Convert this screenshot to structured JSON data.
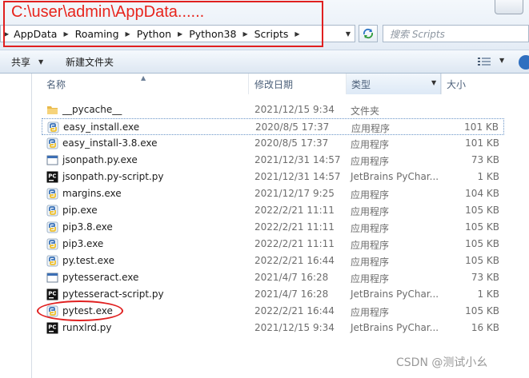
{
  "annotation": {
    "text": "C:\\user\\admin\\AppData......"
  },
  "breadcrumb": [
    "AppData",
    "Roaming",
    "Python",
    "Python38",
    "Scripts"
  ],
  "search": {
    "placeholder": "搜索 Scripts"
  },
  "toolbar": {
    "share_label": "共享",
    "new_folder_label": "新建文件夹"
  },
  "columns": {
    "name": "名称",
    "date": "修改日期",
    "type": "类型",
    "size": "大小"
  },
  "files": [
    {
      "name": "__pycache__",
      "date": "2021/12/15 9:34",
      "type": "文件夹",
      "size": "",
      "icon": "folder-icon"
    },
    {
      "name": "easy_install.exe",
      "date": "2020/8/5 17:37",
      "type": "应用程序",
      "size": "101 KB",
      "icon": "python-exe-icon"
    },
    {
      "name": "easy_install-3.8.exe",
      "date": "2020/8/5 17:37",
      "type": "应用程序",
      "size": "101 KB",
      "icon": "python-exe-icon"
    },
    {
      "name": "jsonpath.py.exe",
      "date": "2021/12/31 14:57",
      "type": "应用程序",
      "size": "73 KB",
      "icon": "window-exe-icon"
    },
    {
      "name": "jsonpath.py-script.py",
      "date": "2021/12/31 14:57",
      "type": "JetBrains PyChar...",
      "size": "1 KB",
      "icon": "pycharm-file-icon"
    },
    {
      "name": "margins.exe",
      "date": "2021/12/17 9:25",
      "type": "应用程序",
      "size": "104 KB",
      "icon": "python-exe-icon"
    },
    {
      "name": "pip.exe",
      "date": "2022/2/21 11:11",
      "type": "应用程序",
      "size": "105 KB",
      "icon": "python-exe-icon"
    },
    {
      "name": "pip3.8.exe",
      "date": "2022/2/21 11:11",
      "type": "应用程序",
      "size": "105 KB",
      "icon": "python-exe-icon"
    },
    {
      "name": "pip3.exe",
      "date": "2022/2/21 11:11",
      "type": "应用程序",
      "size": "105 KB",
      "icon": "python-exe-icon"
    },
    {
      "name": "py.test.exe",
      "date": "2022/2/21 16:44",
      "type": "应用程序",
      "size": "105 KB",
      "icon": "python-exe-icon"
    },
    {
      "name": "pytesseract.exe",
      "date": "2021/4/7 16:28",
      "type": "应用程序",
      "size": "73 KB",
      "icon": "window-exe-icon"
    },
    {
      "name": "pytesseract-script.py",
      "date": "2021/4/7 16:28",
      "type": "JetBrains PyChar...",
      "size": "1 KB",
      "icon": "pycharm-file-icon"
    },
    {
      "name": "pytest.exe",
      "date": "2022/2/21 16:44",
      "type": "应用程序",
      "size": "105 KB",
      "icon": "python-exe-icon"
    },
    {
      "name": "runxlrd.py",
      "date": "2021/12/15 9:34",
      "type": "JetBrains PyChar...",
      "size": "16 KB",
      "icon": "pycharm-file-icon"
    }
  ],
  "watermark": "CSDN @测试小幺"
}
